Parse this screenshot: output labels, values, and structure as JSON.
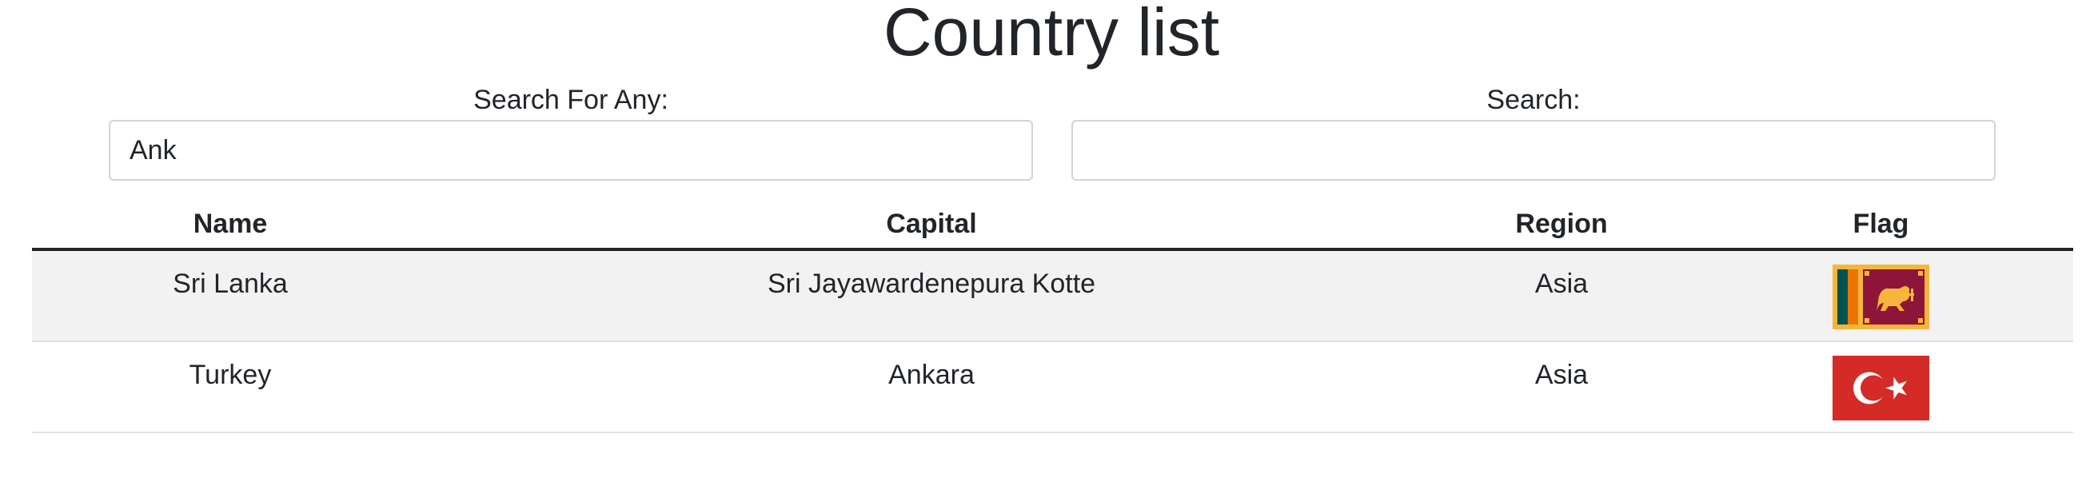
{
  "page": {
    "title": "Country list"
  },
  "search": {
    "any_label": "Search For Any:",
    "any_value": "Ank",
    "any_placeholder": "",
    "field_label": "Search:",
    "field_value": "",
    "field_placeholder": ""
  },
  "table": {
    "headers": [
      "Name",
      "Capital",
      "Region",
      "Flag"
    ],
    "rows": [
      {
        "name": "Sri Lanka",
        "capital": "Sri Jayawardenepura Kotte",
        "region": "Asia",
        "flag": "sri-lanka-flag"
      },
      {
        "name": "Turkey",
        "capital": "Ankara",
        "region": "Asia",
        "flag": "turkey-flag"
      }
    ]
  },
  "colors": {
    "text": "#212529",
    "stripe": "#f2f2f2",
    "border": "#dee2e6",
    "input_border": "#ced4da"
  }
}
